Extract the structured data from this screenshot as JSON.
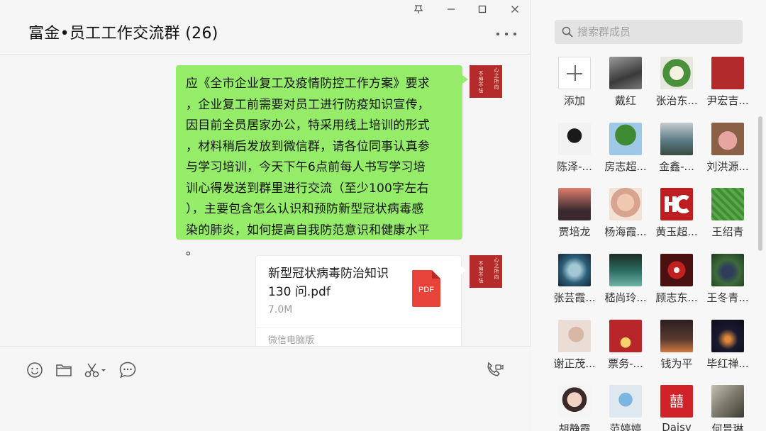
{
  "window": {
    "pin": "ᅐ",
    "minimize": "—",
    "maximize": "☐",
    "close": "✕"
  },
  "chat": {
    "title": "富金•员工工作交流群 (26)",
    "message_lines": [
      "应《全市企业复工及疫情防控工作方案》要求",
      "，企业复工前需要对员工进行防疫知识宣传，",
      "因目前全员居家办公，特采用线上培训的形式",
      "，材料稍后发放到微信群，请各位同事认真参",
      "与学习培训，今天下午6点前每人书写学习培",
      "训心得发送到群里进行交流（至少100字左右",
      "），主要包含怎么认识和预防新型冠状病毒感",
      "染的肺炎，如何提高自我防范意识和健康水平",
      "。"
    ],
    "file": {
      "name": "新型冠状病毒防治知识 130 问.pdf",
      "size": "7.0M",
      "type_label": "PDF",
      "source": "微信电脑版"
    }
  },
  "sidebar": {
    "search_placeholder": "搜索群成员",
    "add_label": "添加",
    "members": [
      {
        "name": "戴红",
        "color": "#6b6b6b"
      },
      {
        "name": "张治东...",
        "color": "#4a8f3a"
      },
      {
        "name": "尹宏吉...",
        "color": "#b32a2a"
      },
      {
        "name": "陈泽-...",
        "color": "#f0f0f0"
      },
      {
        "name": "房志超...",
        "color": "#4f9a45"
      },
      {
        "name": "金鑫-...",
        "color": "#5c7a86"
      },
      {
        "name": "刘洪源...",
        "color": "#c98a6a"
      },
      {
        "name": "贾培龙",
        "color": "#3a2a30"
      },
      {
        "name": "杨海霞...",
        "color": "#d6a48f"
      },
      {
        "name": "黄玉超...",
        "color": "#c01d22"
      },
      {
        "name": "王绍青",
        "color": "#5aa84a"
      },
      {
        "name": "张芸霞...",
        "color": "#2d5e78"
      },
      {
        "name": "嵇尚玲...",
        "color": "#2a6a5e"
      },
      {
        "name": "顾志东...",
        "color": "#4b1010"
      },
      {
        "name": "王冬青...",
        "color": "#3e6a3a"
      },
      {
        "name": "谢正茂...",
        "color": "#e9ddd6"
      },
      {
        "name": "票务-...",
        "color": "#b9262a"
      },
      {
        "name": "钱为平",
        "color": "#2a1e1e"
      },
      {
        "name": "毕红禅...",
        "color": "#1a1a30"
      },
      {
        "name": "胡静霞",
        "color": "#e8c4b8"
      },
      {
        "name": "范婷婷",
        "color": "#dfe8ef"
      },
      {
        "name": "Daisy",
        "color": "#cf2229"
      },
      {
        "name": "何景琳",
        "color": "#7d7a6d"
      }
    ]
  },
  "self_avatar": {
    "text_a": "心之所向",
    "text_b": "不惧不怯"
  }
}
